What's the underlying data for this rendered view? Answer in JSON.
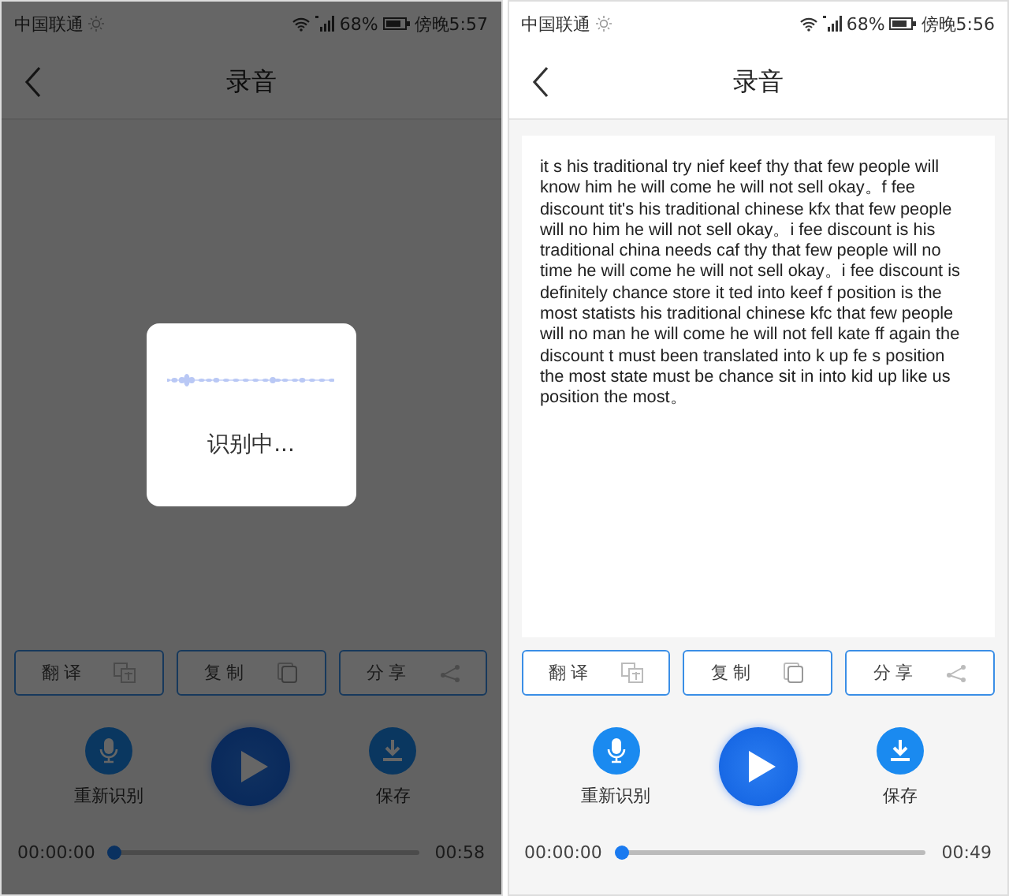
{
  "screens": [
    {
      "status_bar": {
        "carrier": "中国联通",
        "battery": "68%",
        "time": "傍晚5:57"
      },
      "title": "录音",
      "dimmed": true,
      "dialog": {
        "message": "识别中..."
      },
      "actions": [
        {
          "label": "翻译",
          "kind": "translate"
        },
        {
          "label": "复制",
          "kind": "copy"
        },
        {
          "label": "分享",
          "kind": "share"
        }
      ],
      "controls": {
        "rerecognize": "重新识别",
        "save": "保存"
      },
      "player": {
        "elapsed": "00:00:00",
        "level": 0,
        "total": "00:58"
      }
    },
    {
      "status_bar": {
        "carrier": "中国联通",
        "battery": "68%",
        "time": "傍晚5:56"
      },
      "title": "录音",
      "dimmed": false,
      "transcript": "it s his traditional try nief keef thy that few people will know him he will come he will not sell okay。f fee discount tit's his traditional chinese kfx that few people will no him he will not sell okay。i fee discount is his traditional china needs caf thy that few people will no time he will come he will not sell okay。i fee discount is definitely chance store it ted into keef f position is the most statists his traditional chinese kfc that few people will no man he will come he will not fell kate ff again the discount t must been translated into k up fe s position the most state must be chance sit in into kid up like us position the most。",
      "actions": [
        {
          "label": "翻译",
          "kind": "translate"
        },
        {
          "label": "复制",
          "kind": "copy"
        },
        {
          "label": "分享",
          "kind": "share"
        }
      ],
      "controls": {
        "rerecognize": "重新识别",
        "save": "保存"
      },
      "player": {
        "elapsed": "00:00:00",
        "level": 0,
        "total": "00:49"
      }
    }
  ]
}
